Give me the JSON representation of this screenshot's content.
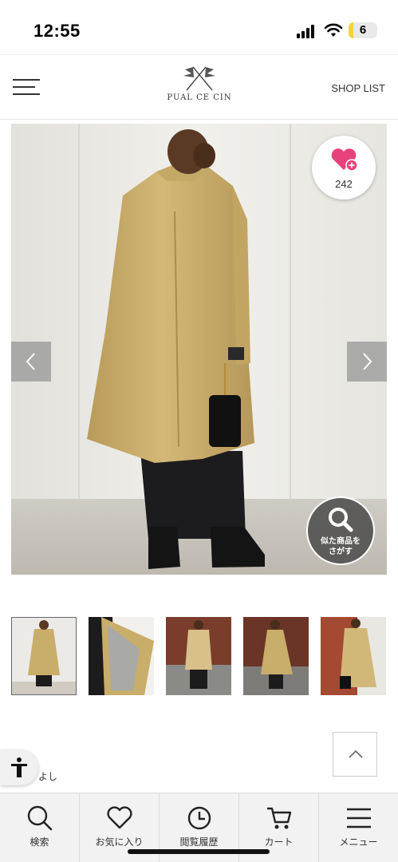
{
  "status_bar": {
    "time": "12:55",
    "battery": "6"
  },
  "header": {
    "logo_text": "PUAL CE CIN",
    "shop_list": "SHOP LIST"
  },
  "product": {
    "favorite_count": "242",
    "similar_search_line1": "似た商品を",
    "similar_search_line2": "さがす",
    "thumbnail_count": 5,
    "selected_thumbnail": 1
  },
  "snippet_text": "よし",
  "tabbar": {
    "items": [
      {
        "label": "検索",
        "icon": "search-icon"
      },
      {
        "label": "お気に入り",
        "icon": "heart-icon"
      },
      {
        "label": "閲覧履歴",
        "icon": "clock-icon"
      },
      {
        "label": "カート",
        "icon": "cart-icon"
      },
      {
        "label": "メニュー",
        "icon": "menu-icon"
      }
    ]
  },
  "colors": {
    "heart": "#e8427c",
    "coat": "#c9ad6a",
    "overlay": "#464646"
  }
}
